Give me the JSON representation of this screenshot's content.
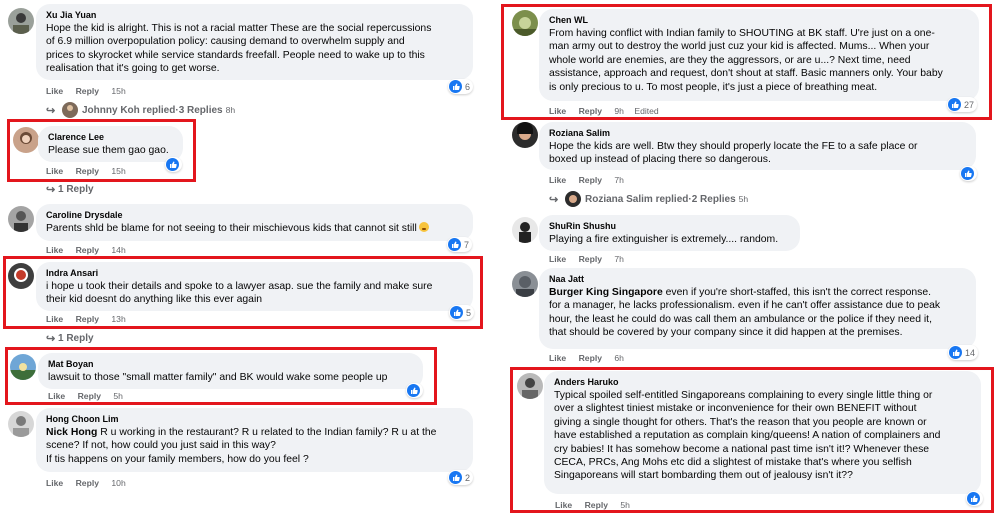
{
  "left": {
    "xu": {
      "author": "Xu Jia Yuan",
      "lines": [
        "Hope the kid is alright. This is not a racial matter These are the social repercussions",
        "of 6.9 million overpopulation policy: causing demand to overwhelm supply and",
        "prices to skyrocket while service standards freefall. People need to wake up to this",
        "realisation that it's going to get worse."
      ],
      "like": "Like",
      "reply": "Reply",
      "time": "15h",
      "reactions": "6",
      "replies": {
        "name": "Johnny Koh replied",
        "sep": " · ",
        "count": "3 Replies",
        "time": "8h"
      }
    },
    "clarence": {
      "author": "Clarence Lee",
      "text": "Please sue them gao gao.",
      "like": "Like",
      "reply": "Reply",
      "time": "15h",
      "replies": "1 Reply"
    },
    "caroline": {
      "author": "Caroline Drysdale",
      "text": "Parents shld be blame for not seeing to their mischievous kids that cannot sit still",
      "like": "Like",
      "reply": "Reply",
      "time": "14h",
      "reactions": "7"
    },
    "indra": {
      "author": "Indra Ansari",
      "lines": [
        "i hope u took their details and spoke to a lawyer asap. sue the family and make sure",
        "their kid doesnt do anything like this ever again"
      ],
      "like": "Like",
      "reply": "Reply",
      "time": "13h",
      "reactions": "5",
      "replies": "1 Reply"
    },
    "mat": {
      "author": "Mat Boyan",
      "text": "lawsuit to those \"small matter family\" and BK would wake some people up",
      "like": "Like",
      "reply": "Reply",
      "time": "5h"
    },
    "hong": {
      "author": "Hong Choon Lim",
      "mention": "Nick Hong",
      "line1": " R u working in the restaurant? R u related to the Indian family? R u at the",
      "lines": [
        "scene? If not, how could you just said in this way?",
        "If tis happens on your family members, how do you feel ?"
      ],
      "like": "Like",
      "reply": "Reply",
      "time": "10h",
      "reactions": "2"
    }
  },
  "right": {
    "chen": {
      "author": "Chen WL",
      "lines": [
        "From having conflict with Indian family to SHOUTING at BK staff. U're just on a one-",
        "man army out to destroy the world just cuz your kid is affected. Mums... When your",
        "whole world are enemies, are they the aggressors, or are u...? Next time, need",
        "assistance, approach and request, don't shout at staff. Basic manners only. Your baby",
        "is only precious to u. To most people, it's just a piece of breathing meat."
      ],
      "like": "Like",
      "reply": "Reply",
      "time": "9h",
      "edited": "Edited",
      "reactions": "27"
    },
    "roziana": {
      "author": "Roziana Salim",
      "lines": [
        "Hope the kids are well. Btw they should properly locate the FE to a safe place or",
        "boxed up instead of placing there so dangerous."
      ],
      "like": "Like",
      "reply": "Reply",
      "time": "7h",
      "replies": {
        "name": "Roziana Salim replied",
        "sep": " · ",
        "count": "2 Replies",
        "time": "5h"
      }
    },
    "shurin": {
      "author": "ShuRin Shushu",
      "text": "Playing a fire extinguisher is extremely.... random.",
      "like": "Like",
      "reply": "Reply",
      "time": "7h"
    },
    "naa": {
      "author": "Naa Jatt",
      "mention": "Burger King Singapore",
      "line1": " even if you're short-staffed, this isn't the correct response.",
      "lines": [
        "for a manager, he lacks professionalism. even if he can't offer assistance due to peak",
        "hour, the least he could do was call them an ambulance or the police if they need it,",
        "that should be covered by your company since it did happen at the premises."
      ],
      "like": "Like",
      "reply": "Reply",
      "time": "6h",
      "reactions": "14"
    },
    "anders": {
      "author": "Anders Haruko",
      "lines": [
        "Typical spoiled self-entitled Singaporeans complaining to every single little thing or",
        "over a slightest tiniest mistake or inconvenience for their own BENEFIT without",
        "giving a single thought for others. That's the reason that you people are known or",
        "have established a reputation as complain king/queens! A nation of complainers and",
        "cry babies! It has somehow become a national past time isn't it!? Whenever these",
        "CECA, PRCs, Ang Mohs etc did a slightest of mistake that's where you selfish",
        "Singaporeans will start bombarding them out of jealousy isn't it??"
      ],
      "like": "Like",
      "reply": "Reply",
      "time": "5h"
    }
  },
  "colors": {
    "highlight": "#e3161d",
    "bubble": "#f0f2f5",
    "like_blue": "#1877f2",
    "meta_gray": "#65676b"
  },
  "icons": [
    "like-icon",
    "angry-emoji-icon",
    "reply-arrow-icon",
    "avatar"
  ]
}
